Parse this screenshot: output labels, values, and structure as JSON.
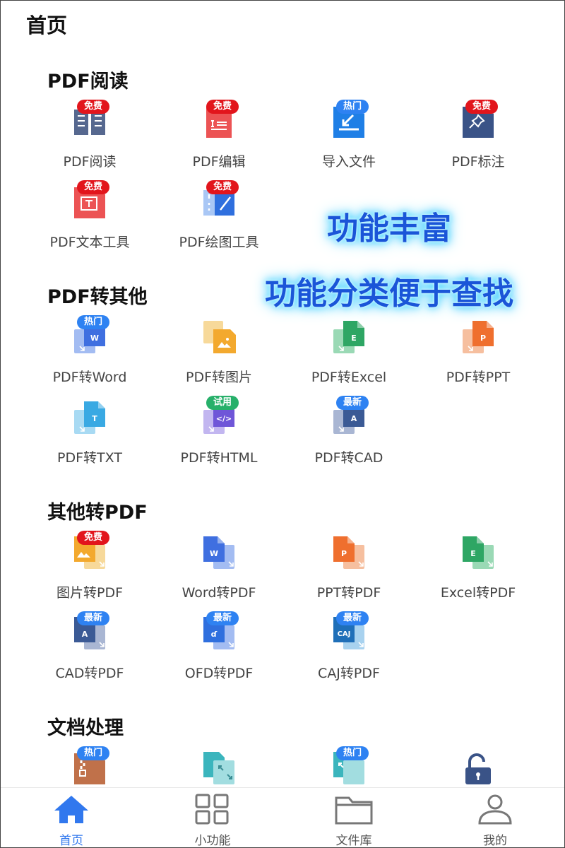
{
  "header": {
    "title": "首页"
  },
  "promo": {
    "line1": "功能丰富",
    "line2": "功能分类便于查找"
  },
  "sections": [
    {
      "title": "PDF阅读",
      "items": [
        {
          "label": "PDF阅读",
          "badge": "免费",
          "badge_color": "red",
          "icon": "pdf-reader-icon"
        },
        {
          "label": "PDF编辑",
          "badge": "免费",
          "badge_color": "red",
          "icon": "pdf-edit-icon"
        },
        {
          "label": "导入文件",
          "badge": "热门",
          "badge_color": "blue",
          "icon": "import-file-icon"
        },
        {
          "label": "PDF标注",
          "badge": "免费",
          "badge_color": "red",
          "icon": "pdf-annotate-icon"
        },
        {
          "label": "PDF文本工具",
          "badge": "免费",
          "badge_color": "red",
          "icon": "pdf-text-tool-icon"
        },
        {
          "label": "PDF绘图工具",
          "badge": "免费",
          "badge_color": "red",
          "icon": "pdf-draw-tool-icon"
        }
      ]
    },
    {
      "title": "PDF转其他",
      "items": [
        {
          "label": "PDF转Word",
          "badge": "热门",
          "badge_color": "blue",
          "icon": "pdf-to-word-icon"
        },
        {
          "label": "PDF转图片",
          "badge": "",
          "badge_color": "",
          "icon": "pdf-to-image-icon"
        },
        {
          "label": "PDF转Excel",
          "badge": "",
          "badge_color": "",
          "icon": "pdf-to-excel-icon"
        },
        {
          "label": "PDF转PPT",
          "badge": "",
          "badge_color": "",
          "icon": "pdf-to-ppt-icon"
        },
        {
          "label": "PDF转TXT",
          "badge": "",
          "badge_color": "",
          "icon": "pdf-to-txt-icon"
        },
        {
          "label": "PDF转HTML",
          "badge": "试用",
          "badge_color": "green",
          "icon": "pdf-to-html-icon"
        },
        {
          "label": "PDF转CAD",
          "badge": "最新",
          "badge_color": "blue",
          "icon": "pdf-to-cad-icon"
        }
      ]
    },
    {
      "title": "其他转PDF",
      "items": [
        {
          "label": "图片转PDF",
          "badge": "免费",
          "badge_color": "red",
          "icon": "image-to-pdf-icon"
        },
        {
          "label": "Word转PDF",
          "badge": "",
          "badge_color": "",
          "icon": "word-to-pdf-icon"
        },
        {
          "label": "PPT转PDF",
          "badge": "",
          "badge_color": "",
          "icon": "ppt-to-pdf-icon"
        },
        {
          "label": "Excel转PDF",
          "badge": "",
          "badge_color": "",
          "icon": "excel-to-pdf-icon"
        },
        {
          "label": "CAD转PDF",
          "badge": "最新",
          "badge_color": "blue",
          "icon": "cad-to-pdf-icon"
        },
        {
          "label": "OFD转PDF",
          "badge": "最新",
          "badge_color": "blue",
          "icon": "ofd-to-pdf-icon"
        },
        {
          "label": "CAJ转PDF",
          "badge": "最新",
          "badge_color": "blue",
          "icon": "caj-to-pdf-icon"
        }
      ]
    },
    {
      "title": "文档处理",
      "items": [
        {
          "label": "",
          "badge": "热门",
          "badge_color": "blue",
          "icon": "compress-file-icon"
        },
        {
          "label": "",
          "badge": "",
          "badge_color": "",
          "icon": "merge-file-icon"
        },
        {
          "label": "",
          "badge": "热门",
          "badge_color": "blue",
          "icon": "split-file-icon"
        },
        {
          "label": "",
          "badge": "",
          "badge_color": "",
          "icon": "unlock-pdf-icon"
        }
      ]
    }
  ],
  "bottom_nav": [
    {
      "label": "首页",
      "icon": "home-icon",
      "active": true
    },
    {
      "label": "小功能",
      "icon": "grid-icon",
      "active": false
    },
    {
      "label": "文件库",
      "icon": "folder-icon",
      "active": false
    },
    {
      "label": "我的",
      "icon": "user-icon",
      "active": false
    }
  ],
  "colors": {
    "accent": "#3178ee",
    "badge_red": "#e2151c",
    "badge_blue": "#2e82f2",
    "badge_green": "#27b06a",
    "promo_text": "#1a55d8"
  }
}
